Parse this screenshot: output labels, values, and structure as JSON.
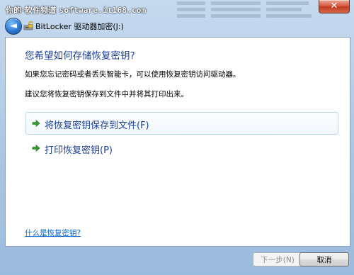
{
  "watermark": {
    "text_cn": "你的·软件频道",
    "url": "software.it168.com"
  },
  "window": {
    "title": "BitLocker 驱动器加密(J:)",
    "close_glyph": "✕"
  },
  "nav": {
    "back_glyph": "◄"
  },
  "content": {
    "heading": "您希望如何存储恢复密钥?",
    "para1": "如果您忘记密码或者丢失智能卡，可以使用恢复密钥访问驱动器。",
    "para2": "建议您将恢复密钥保存到文件中并将其打印出来。",
    "options": [
      {
        "label": "将恢复密钥保存到文件(F)",
        "icon": "green-arrow-icon"
      },
      {
        "label": "打印恢复密钥(P)",
        "icon": "green-arrow-icon"
      }
    ],
    "help_link": "什么是恢复密钥?"
  },
  "footer": {
    "next_label": "下一步(N)",
    "cancel_label": "取消"
  },
  "colors": {
    "heading": "#1c3f94",
    "link": "#0066cc",
    "arrow": "#2f9e2f"
  }
}
